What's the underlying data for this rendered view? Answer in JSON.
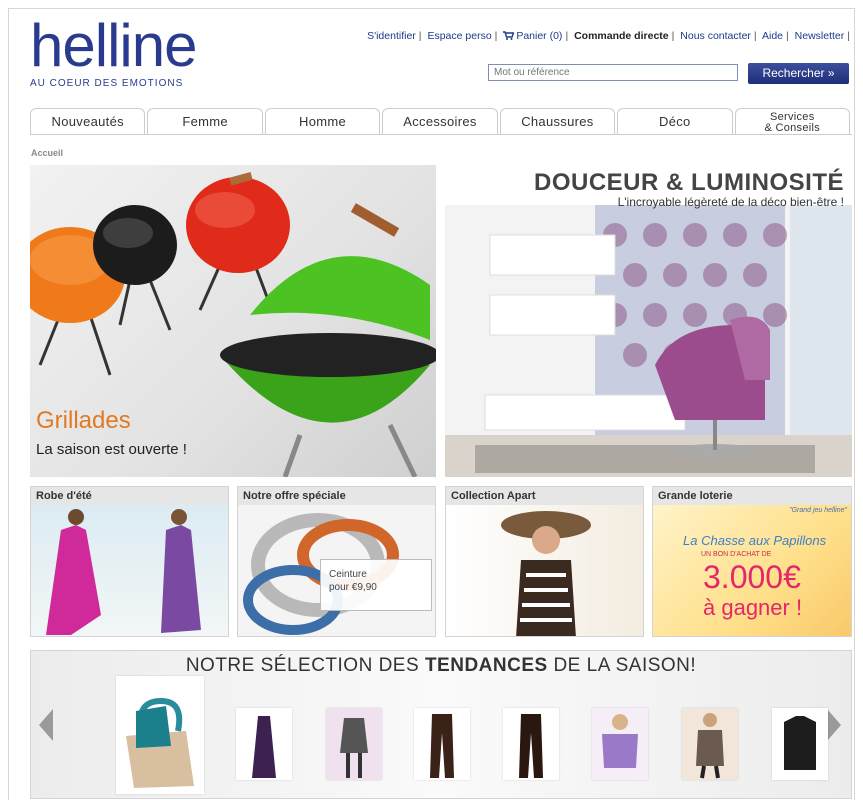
{
  "logo": {
    "name": "helline",
    "tagline": "AU COEUR DES EMOTIONS"
  },
  "toplinks": {
    "signin": "S'identifier",
    "espace": "Espace perso",
    "cart": "Panier (0)",
    "commande": "Commande directe",
    "contact": "Nous contacter",
    "aide": "Aide",
    "newsletter": "Newsletter"
  },
  "search": {
    "placeholder": "Mot ou référence",
    "button": "Rechercher »"
  },
  "nav": {
    "tabs": [
      "Nouveautés",
      "Femme",
      "Homme",
      "Accessoires",
      "Chaussures",
      "Déco"
    ],
    "services_line1": "Services",
    "services_line2": "& Conseils"
  },
  "breadcrumb": "Accueil",
  "banner_grill": {
    "title": "Grillades",
    "subtitle": "La saison est ouverte !"
  },
  "banner_deco": {
    "title": "DOUCEUR & LUMINOSITÉ",
    "subtitle": "L'incroyable légèreté de la déco bien-être !"
  },
  "tiles": {
    "robe": "Robe d'été",
    "offre": "Notre offre spéciale",
    "offre_caption1": "Ceinture",
    "offre_caption2": "pour €9,90",
    "collection": "Collection Apart",
    "loterie": "Grande loterie",
    "loterie_small": "\"Grand jeu helline\"",
    "loterie_title": "La Chasse aux Papillons",
    "loterie_line": "UN BON D'ACHAT DE",
    "loterie_amount": "3.000€",
    "loterie_gagner": "à gagner !"
  },
  "trends": {
    "title_part1": "NOTRE SÉLECTION DES ",
    "title_bold": "TENDANCES",
    "title_part2": " DE LA SAISON!"
  },
  "colors": {
    "brand": "#2a3b8f",
    "accent_orange": "#e07a24",
    "lottery_pink": "#e6266b"
  }
}
